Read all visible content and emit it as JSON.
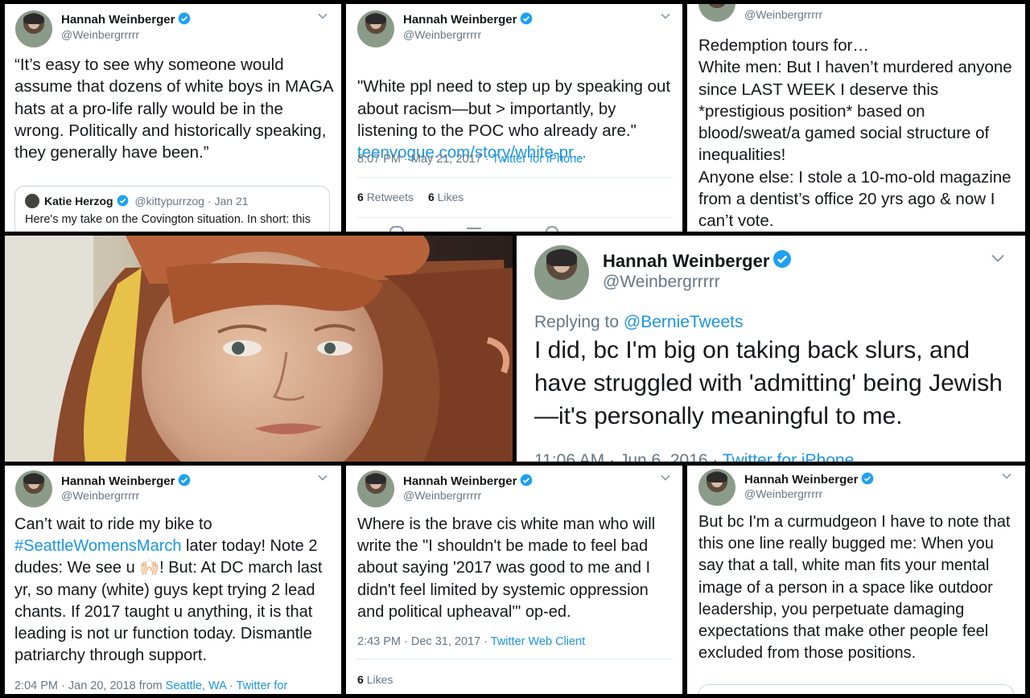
{
  "colors": {
    "link": "#1b95e0",
    "muted": "#657786",
    "verified": "#1da1f2",
    "text": "#14171a"
  },
  "tweets": [
    {
      "author": "Hannah Weinberger",
      "handle": "@Weinbergrrrrr",
      "text": "“It’s easy to see why someone would assume that dozens of white boys in MAGA hats at a pro-life rally would be in the wrong. Politically and historically speaking, they generally have been.”",
      "quote": {
        "author": "Katie Herzog",
        "handle": "@kittypurrzog",
        "date": "· Jan 21",
        "text": "Here's my take on the Covington situation. In short: this"
      }
    },
    {
      "author": "Hannah Weinberger",
      "handle": "@Weinbergrrrrr",
      "text": "\"White ppl need to step up by speaking out about racism—but > importantly, by listening to the POC who already are.\"",
      "link": "teenvogue.com/story/white-pr...",
      "time": "8:07 PM · May 21, 2017 · ",
      "source": "Twitter for iPhone",
      "retweets_count": "6",
      "retweets_label": "Retweets",
      "likes_count": "6",
      "likes_label": "Likes"
    },
    {
      "handle": "@Weinbergrrrrr",
      "text": "Redemption tours for…\nWhite men: But I haven’t murdered anyone since LAST WEEK I deserve this *prestigious position* based on blood/sweat/a gamed social structure of inequalities!\nAnyone else: I stole a 10-mo-old magazine from a dentist’s office 20 yrs ago & now I can’t vote."
    },
    {
      "author": "Hannah Weinberger",
      "handle": "@Weinbergrrrrr",
      "replying_prefix": "Replying to ",
      "replying_to": "@BernieTweets",
      "text": "I did, bc I'm big on taking back slurs, and have struggled with 'admitting' being Jewish—it's personally meaningful to me.",
      "time": "11:06 AM · Jun 6, 2016 · ",
      "source": "Twitter for iPhone"
    },
    {
      "author": "Hannah Weinberger",
      "handle": "@Weinbergrrrrr",
      "text_before_tag": "Can’t wait to ride my bike to ",
      "hashtag": "#SeattleWomensMarch",
      "text_after_tag": " later today! Note 2 dudes: We see u 🙌🏻! But: At DC march last yr, so many (white) guys kept trying 2 lead chants. If 2017 taught u anything, it is that leading is not ur function today. Dismantle patriarchy through support.",
      "time": "2:04 PM · Jan 20, 2018 from ",
      "location": "Seattle, WA",
      "source": " · Twitter for"
    },
    {
      "author": "Hannah Weinberger",
      "handle": "@Weinbergrrrrr",
      "text": "Where is the brave cis white man who will write the \"I shouldn't be made to feel bad about saying '2017 was good to me and I didn't feel limited by systemic oppression and political upheaval'\" op-ed.",
      "time": "2:43 PM · Dec 31, 2017 · ",
      "source": "Twitter Web Client",
      "likes_count": "6",
      "likes_label": "Likes"
    },
    {
      "author": "Hannah Weinberger",
      "handle": "@Weinbergrrrrr",
      "text": "But bc I'm a curmudgeon I have to note that this one line really bugged me: When you say that a tall, white man fits your mental image of a person in a space like outdoor leadership, you perpetuate damaging expectations that make other people feel excluded from those positions."
    }
  ]
}
